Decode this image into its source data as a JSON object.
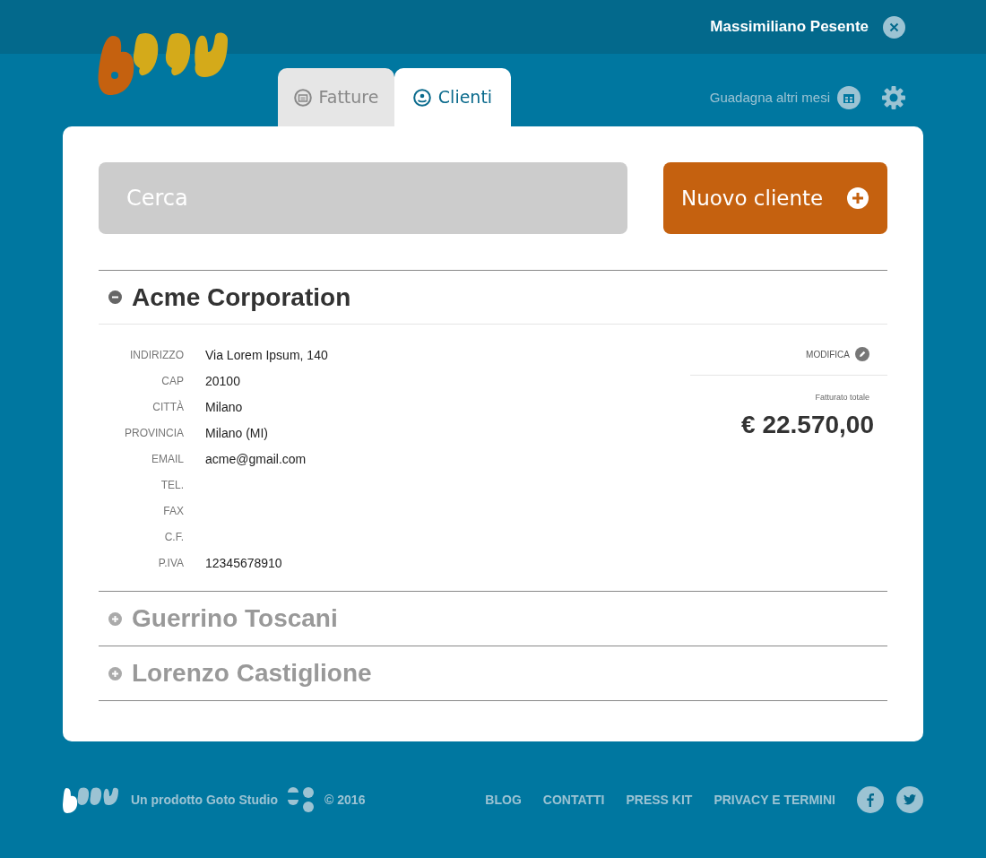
{
  "user": {
    "name": "Massimiliano Pesente"
  },
  "tabs": [
    {
      "label": "Fatture",
      "selected": false
    },
    {
      "label": "Clienti",
      "selected": true
    }
  ],
  "promo": "Guadagna altri mesi",
  "search": {
    "placeholder": "Cerca"
  },
  "new_button": "Nuovo cliente",
  "clients": [
    {
      "name": "Acme Corporation",
      "expanded": true,
      "fields": [
        {
          "label": "INDIRIZZO",
          "value": "Via Lorem Ipsum, 140"
        },
        {
          "label": "CAP",
          "value": "20100"
        },
        {
          "label": "CITTÀ",
          "value": "Milano"
        },
        {
          "label": "PROVINCIA",
          "value": "Milano (MI)"
        },
        {
          "label": "EMAIL",
          "value": "acme@gmail.com"
        },
        {
          "label": "TEL."
        },
        {
          "label": "FAX"
        },
        {
          "label": "C.F."
        },
        {
          "label": "P.IVA",
          "value": "12345678910"
        }
      ],
      "edit": "MODIFICA",
      "total_label": "Fatturato totale",
      "total": "€ 22.570,00"
    },
    {
      "name": "Guerrino Toscani",
      "expanded": false
    },
    {
      "name": "Lorenzo Castiglione",
      "expanded": false
    }
  ],
  "footer": {
    "credit": "Un prodotto Goto Studio",
    "copyright": "© 2016",
    "links": [
      "BLOG",
      "CONTATTI",
      "PRESS KIT",
      "PRIVACY E TERMINI"
    ]
  }
}
